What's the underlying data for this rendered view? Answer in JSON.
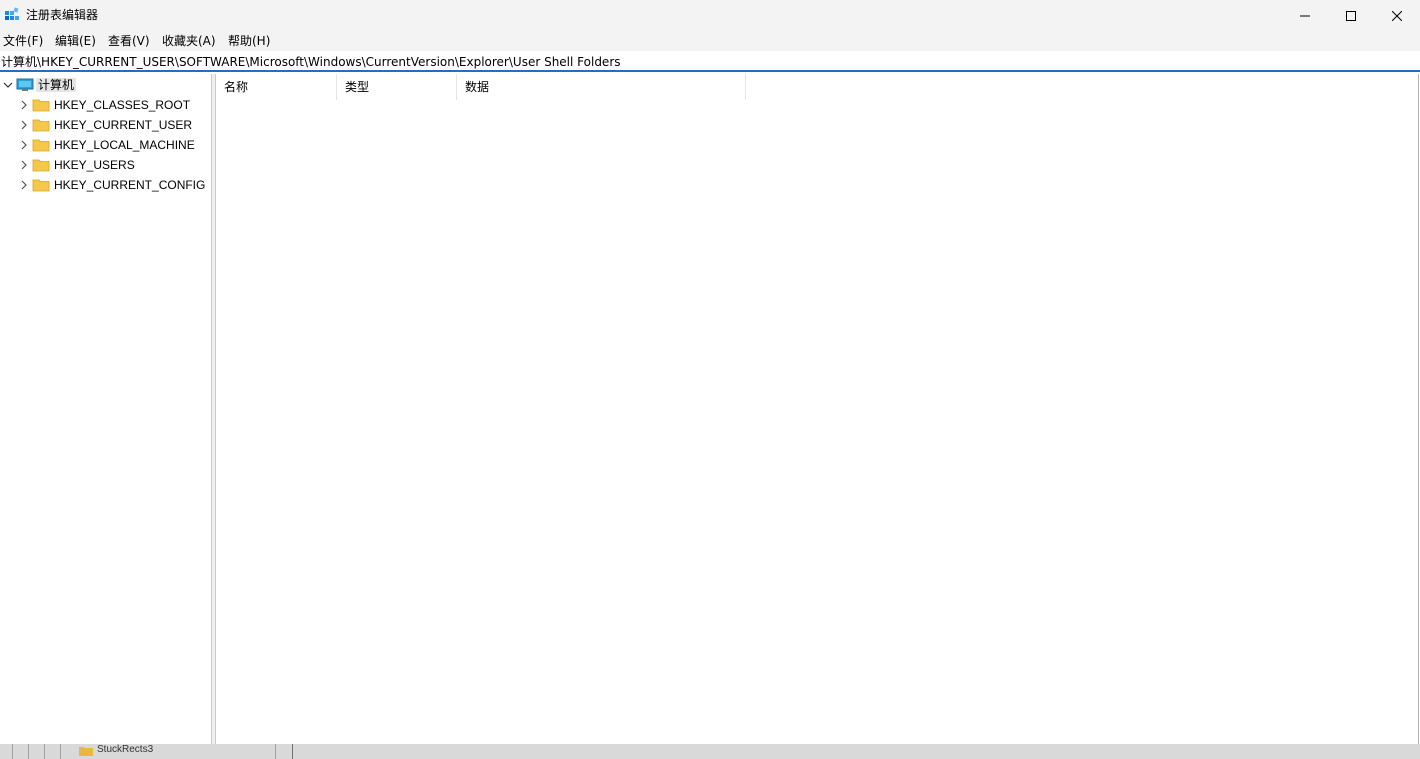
{
  "window": {
    "title": "注册表编辑器"
  },
  "menu": {
    "file": "文件(F)",
    "edit": "编辑(E)",
    "view": "查看(V)",
    "favorites": "收藏夹(A)",
    "help": "帮助(H)"
  },
  "address": {
    "path": "计算机\\HKEY_CURRENT_USER\\SOFTWARE\\Microsoft\\Windows\\CurrentVersion\\Explorer\\User Shell Folders"
  },
  "tree": {
    "root": "计算机",
    "items": [
      {
        "label": "HKEY_CLASSES_ROOT"
      },
      {
        "label": "HKEY_CURRENT_USER"
      },
      {
        "label": "HKEY_LOCAL_MACHINE"
      },
      {
        "label": "HKEY_USERS"
      },
      {
        "label": "HKEY_CURRENT_CONFIG"
      }
    ]
  },
  "list": {
    "columns": [
      "名称",
      "类型",
      "数据"
    ]
  },
  "background": {
    "label": "StuckRects3"
  },
  "colors": {
    "accent": "#2b6cb7",
    "folder": "#f5c84c",
    "titlebar": "#f3f3f3"
  },
  "icons": {
    "app": "registry-editor-icon",
    "computer": "computer-icon",
    "folder": "folder-icon"
  }
}
